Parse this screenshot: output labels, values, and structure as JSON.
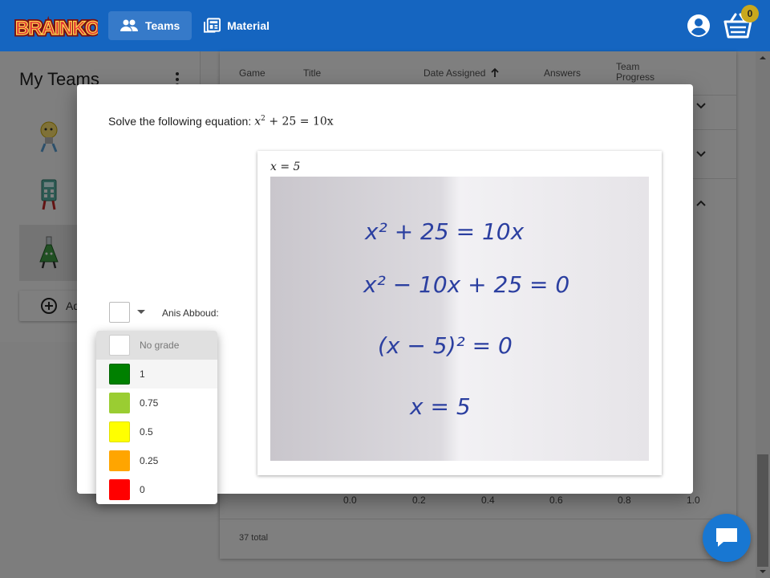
{
  "app": {
    "logo_text": "BRAINKOS",
    "nav": [
      {
        "label": "Teams",
        "icon": "people-icon",
        "active": true
      },
      {
        "label": "Material",
        "icon": "newspaper-icon",
        "active": false
      }
    ],
    "basket_count": "0",
    "brand_color": "#1565c0"
  },
  "teams_panel": {
    "title": "My Teams",
    "add_label": "Add team",
    "teams": [
      {
        "icon": "lightbulb-mascot-icon"
      },
      {
        "icon": "calculator-mascot-icon"
      },
      {
        "icon": "flask-mascot-icon",
        "selected": true
      }
    ]
  },
  "table": {
    "headers": [
      "Game",
      "Title",
      "Date Assigned",
      "Answers",
      "Team Progress"
    ],
    "sort_column": "Date Assigned",
    "sort_direction": "ascending",
    "axis_ticks": [
      "0.0",
      "0.2",
      "0.4",
      "0.6",
      "0.8",
      "1.0"
    ],
    "total": "37 total"
  },
  "dialog": {
    "question_prefix": "Solve the following equation:",
    "question_math": {
      "base": "x",
      "exp": "2",
      "rest": "+ 25 = 10x"
    },
    "answer_math": "x = 5",
    "handwriting": {
      "line1": "x² + 25 = 10x",
      "line2": "x² − 10x + 25 = 0",
      "line3": "(x − 5)² = 0",
      "line4": "x = 5"
    },
    "student_name": "Anis Abboud:",
    "grade_selected": "",
    "grade_options": [
      {
        "label": "No grade",
        "color": "#ffffff",
        "disabled": true
      },
      {
        "label": "1",
        "color": "#008000"
      },
      {
        "label": "0.75",
        "color": "#9acd32"
      },
      {
        "label": "0.5",
        "color": "#ffff00"
      },
      {
        "label": "0.25",
        "color": "#ffa500"
      },
      {
        "label": "0",
        "color": "#ff0000"
      }
    ]
  }
}
